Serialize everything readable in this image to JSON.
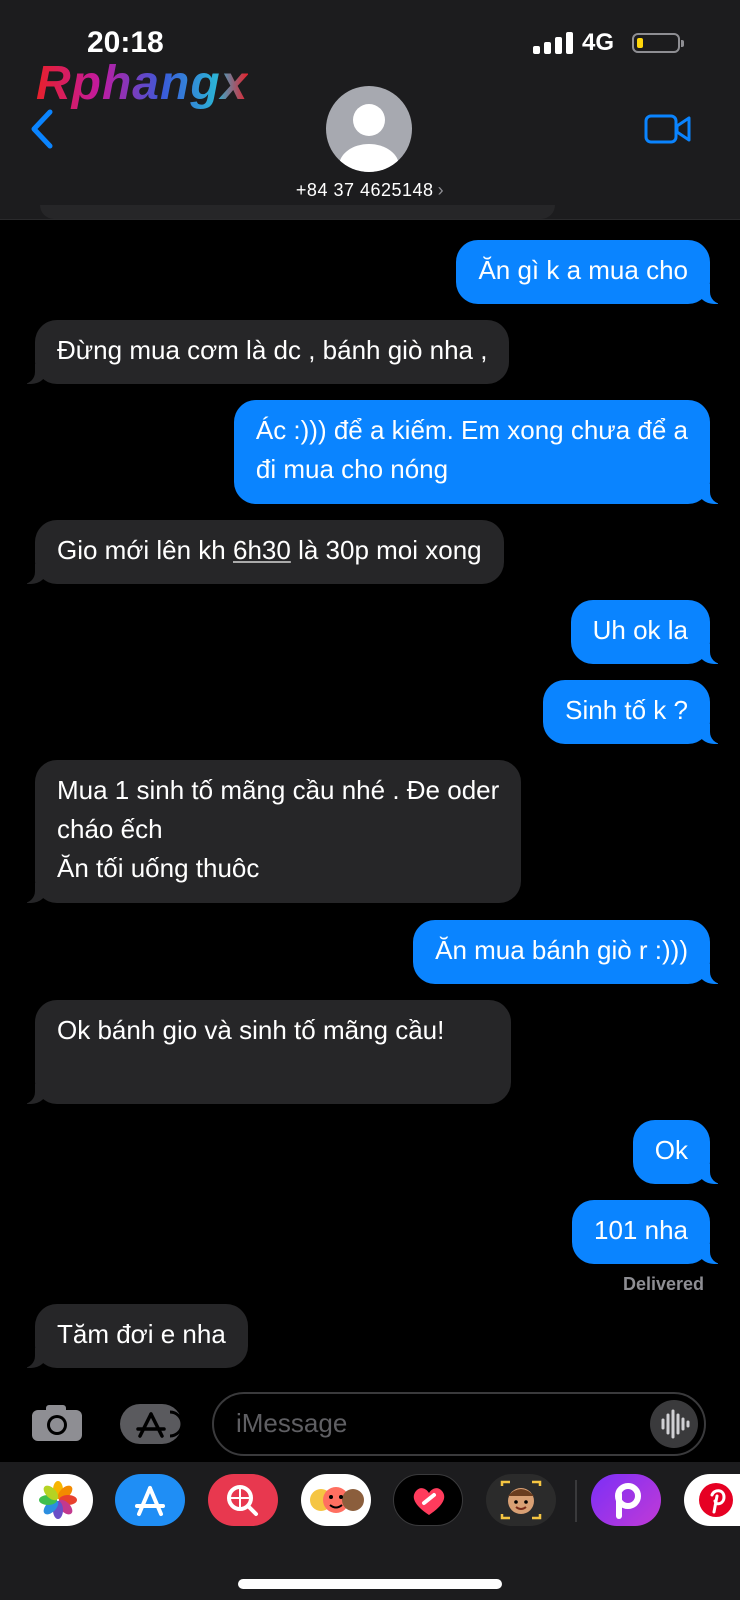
{
  "status_bar": {
    "time": "20:18",
    "network": "4G"
  },
  "watermark": "Rphangx",
  "header": {
    "contact": "+84 37 4625148",
    "chevron": "›"
  },
  "messages": [
    {
      "dir": "out",
      "text": "Ăn gì k a mua cho"
    },
    {
      "dir": "in",
      "text": "Đừng mua cơm là dc , bánh giò nha ,"
    },
    {
      "dir": "out",
      "text": "Ác :))) để a kiếm. Em xong chưa để a\nđi mua cho nóng"
    },
    {
      "dir": "in",
      "pre": "Gio mới lên kh ",
      "link": "6h30",
      "post": " là 30p moi xong"
    },
    {
      "dir": "out",
      "text": "Uh ok la"
    },
    {
      "dir": "out",
      "text": "Sinh tố k ?"
    },
    {
      "dir": "in",
      "text": "Mua 1 sinh tố mãng cầu nhé . Đe oder\ncháo ếch\nĂn tối uống thuôc"
    },
    {
      "dir": "out",
      "text": "Ăn mua bánh giò r :)))"
    },
    {
      "dir": "in",
      "text": "Ok bánh gio và sinh tố mãng cầu!"
    },
    {
      "dir": "out",
      "text": "Ok"
    },
    {
      "dir": "out",
      "text": "101 nha"
    },
    {
      "dir": "in",
      "text": "Tăm đơi e nha"
    }
  ],
  "delivered": "Delivered",
  "composer": {
    "placeholder": "iMessage"
  },
  "dock": [
    "photos-icon",
    "app-store-icon",
    "search-images-icon",
    "memoji-stickers-icon",
    "digital-touch-icon",
    "memoji-icon",
    "picsart-icon",
    "pinterest-icon"
  ],
  "colors": {
    "outgoing": "#0a84ff",
    "incoming": "#262628",
    "background": "#000000"
  }
}
